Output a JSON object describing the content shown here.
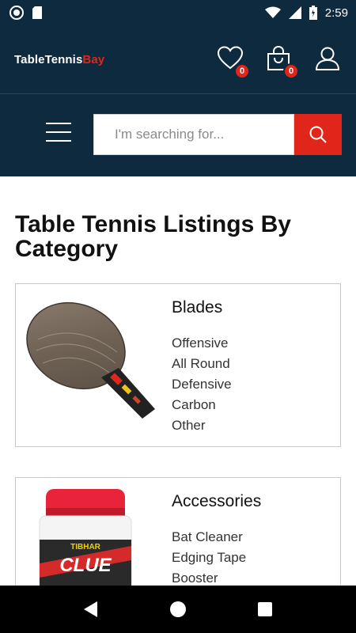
{
  "status_bar": {
    "time": "2:59",
    "icons": [
      "circle-notification-icon",
      "sd-card-icon",
      "wifi-icon",
      "signal-icon",
      "battery-icon"
    ]
  },
  "header": {
    "logo_main": "TableTennis",
    "logo_accent": "Bay",
    "wishlist_count": "0",
    "cart_count": "0",
    "icons": [
      "heart-icon",
      "shopping-bag-icon",
      "user-icon"
    ]
  },
  "search": {
    "placeholder": "I'm searching for...",
    "value": ""
  },
  "main": {
    "title": "Table Tennis Listings By Category",
    "categories": [
      {
        "title": "Blades",
        "links": [
          "Offensive",
          "All Round",
          "Defensive",
          "Carbon",
          "Other"
        ]
      },
      {
        "title": "Accessories",
        "links": [
          "Bat Cleaner",
          "Edging Tape",
          "Booster"
        ],
        "product_label": "CLUE",
        "brand_label": "TIBHAR"
      }
    ]
  },
  "colors": {
    "header_bg": "#0e2a3e",
    "accent": "#e0261b"
  },
  "nav_bar": {
    "icons": [
      "back-icon",
      "home-icon",
      "recents-icon"
    ]
  }
}
